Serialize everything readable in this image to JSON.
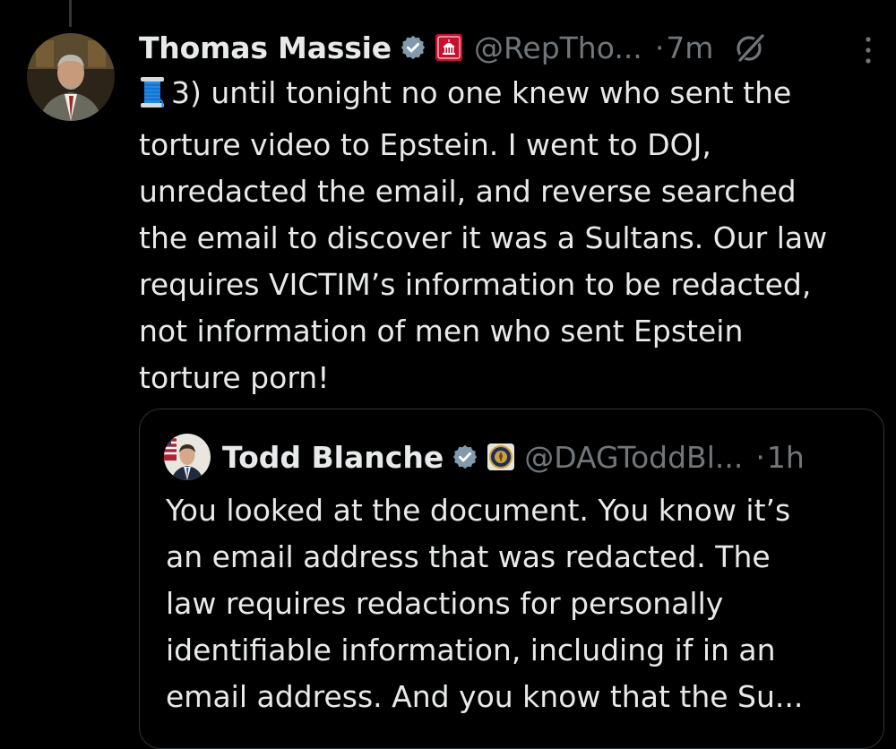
{
  "tweet": {
    "author_name": "Thomas Massie",
    "handle": "@RepTho...",
    "dot": "·",
    "time": "7m",
    "thread_emoji": "spool-of-thread",
    "text": "3) until tonight no one knew who sent the\ntorture video to Epstein. I went to DOJ,\nunredacted the email, and reverse searched\nthe email to discover it was a Sultans. Our law\nrequires VICTIM’s information to be redacted,\nnot information of men who sent Epstein\ntorture porn!"
  },
  "quote": {
    "author_name": "Todd Blanche",
    "handle": "@DAGToddBl...",
    "dot": "·",
    "time": "1h",
    "text": "You looked at the document. You know it’s\nan email address that was redacted. The\nlaw requires redactions for personally\nidentifiable information, including if in an\nemail address. And you know that the Su..."
  },
  "icons": {
    "verified": "verified-badge-icon",
    "affiliation_tweet": "house-gop-affiliation-icon",
    "affiliation_quote": "doj-seal-affiliation-icon",
    "grok": "grok-icon",
    "more": "more-options-icon"
  },
  "colors": {
    "background": "#000000",
    "text_primary": "#e7e9ea",
    "text_secondary": "#71767b",
    "border": "#2f3336",
    "verified": "#829aab"
  }
}
